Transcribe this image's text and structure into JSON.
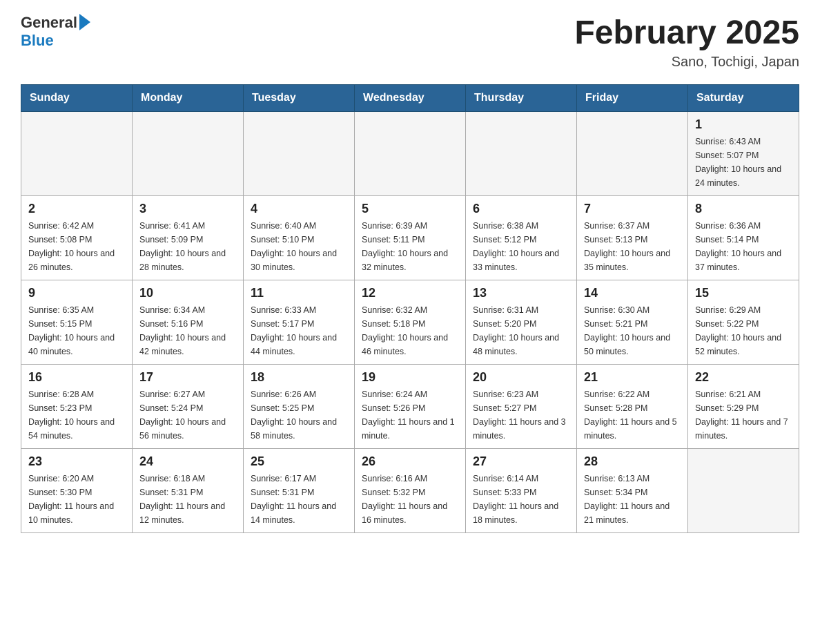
{
  "header": {
    "logo_general": "General",
    "logo_blue": "Blue",
    "title": "February 2025",
    "subtitle": "Sano, Tochigi, Japan"
  },
  "calendar": {
    "days_of_week": [
      "Sunday",
      "Monday",
      "Tuesday",
      "Wednesday",
      "Thursday",
      "Friday",
      "Saturday"
    ],
    "weeks": [
      {
        "days": [
          {
            "number": "",
            "info": ""
          },
          {
            "number": "",
            "info": ""
          },
          {
            "number": "",
            "info": ""
          },
          {
            "number": "",
            "info": ""
          },
          {
            "number": "",
            "info": ""
          },
          {
            "number": "",
            "info": ""
          },
          {
            "number": "1",
            "info": "Sunrise: 6:43 AM\nSunset: 5:07 PM\nDaylight: 10 hours and 24 minutes."
          }
        ]
      },
      {
        "days": [
          {
            "number": "2",
            "info": "Sunrise: 6:42 AM\nSunset: 5:08 PM\nDaylight: 10 hours and 26 minutes."
          },
          {
            "number": "3",
            "info": "Sunrise: 6:41 AM\nSunset: 5:09 PM\nDaylight: 10 hours and 28 minutes."
          },
          {
            "number": "4",
            "info": "Sunrise: 6:40 AM\nSunset: 5:10 PM\nDaylight: 10 hours and 30 minutes."
          },
          {
            "number": "5",
            "info": "Sunrise: 6:39 AM\nSunset: 5:11 PM\nDaylight: 10 hours and 32 minutes."
          },
          {
            "number": "6",
            "info": "Sunrise: 6:38 AM\nSunset: 5:12 PM\nDaylight: 10 hours and 33 minutes."
          },
          {
            "number": "7",
            "info": "Sunrise: 6:37 AM\nSunset: 5:13 PM\nDaylight: 10 hours and 35 minutes."
          },
          {
            "number": "8",
            "info": "Sunrise: 6:36 AM\nSunset: 5:14 PM\nDaylight: 10 hours and 37 minutes."
          }
        ]
      },
      {
        "days": [
          {
            "number": "9",
            "info": "Sunrise: 6:35 AM\nSunset: 5:15 PM\nDaylight: 10 hours and 40 minutes."
          },
          {
            "number": "10",
            "info": "Sunrise: 6:34 AM\nSunset: 5:16 PM\nDaylight: 10 hours and 42 minutes."
          },
          {
            "number": "11",
            "info": "Sunrise: 6:33 AM\nSunset: 5:17 PM\nDaylight: 10 hours and 44 minutes."
          },
          {
            "number": "12",
            "info": "Sunrise: 6:32 AM\nSunset: 5:18 PM\nDaylight: 10 hours and 46 minutes."
          },
          {
            "number": "13",
            "info": "Sunrise: 6:31 AM\nSunset: 5:20 PM\nDaylight: 10 hours and 48 minutes."
          },
          {
            "number": "14",
            "info": "Sunrise: 6:30 AM\nSunset: 5:21 PM\nDaylight: 10 hours and 50 minutes."
          },
          {
            "number": "15",
            "info": "Sunrise: 6:29 AM\nSunset: 5:22 PM\nDaylight: 10 hours and 52 minutes."
          }
        ]
      },
      {
        "days": [
          {
            "number": "16",
            "info": "Sunrise: 6:28 AM\nSunset: 5:23 PM\nDaylight: 10 hours and 54 minutes."
          },
          {
            "number": "17",
            "info": "Sunrise: 6:27 AM\nSunset: 5:24 PM\nDaylight: 10 hours and 56 minutes."
          },
          {
            "number": "18",
            "info": "Sunrise: 6:26 AM\nSunset: 5:25 PM\nDaylight: 10 hours and 58 minutes."
          },
          {
            "number": "19",
            "info": "Sunrise: 6:24 AM\nSunset: 5:26 PM\nDaylight: 11 hours and 1 minute."
          },
          {
            "number": "20",
            "info": "Sunrise: 6:23 AM\nSunset: 5:27 PM\nDaylight: 11 hours and 3 minutes."
          },
          {
            "number": "21",
            "info": "Sunrise: 6:22 AM\nSunset: 5:28 PM\nDaylight: 11 hours and 5 minutes."
          },
          {
            "number": "22",
            "info": "Sunrise: 6:21 AM\nSunset: 5:29 PM\nDaylight: 11 hours and 7 minutes."
          }
        ]
      },
      {
        "days": [
          {
            "number": "23",
            "info": "Sunrise: 6:20 AM\nSunset: 5:30 PM\nDaylight: 11 hours and 10 minutes."
          },
          {
            "number": "24",
            "info": "Sunrise: 6:18 AM\nSunset: 5:31 PM\nDaylight: 11 hours and 12 minutes."
          },
          {
            "number": "25",
            "info": "Sunrise: 6:17 AM\nSunset: 5:31 PM\nDaylight: 11 hours and 14 minutes."
          },
          {
            "number": "26",
            "info": "Sunrise: 6:16 AM\nSunset: 5:32 PM\nDaylight: 11 hours and 16 minutes."
          },
          {
            "number": "27",
            "info": "Sunrise: 6:14 AM\nSunset: 5:33 PM\nDaylight: 11 hours and 18 minutes."
          },
          {
            "number": "28",
            "info": "Sunrise: 6:13 AM\nSunset: 5:34 PM\nDaylight: 11 hours and 21 minutes."
          },
          {
            "number": "",
            "info": ""
          }
        ]
      }
    ]
  }
}
